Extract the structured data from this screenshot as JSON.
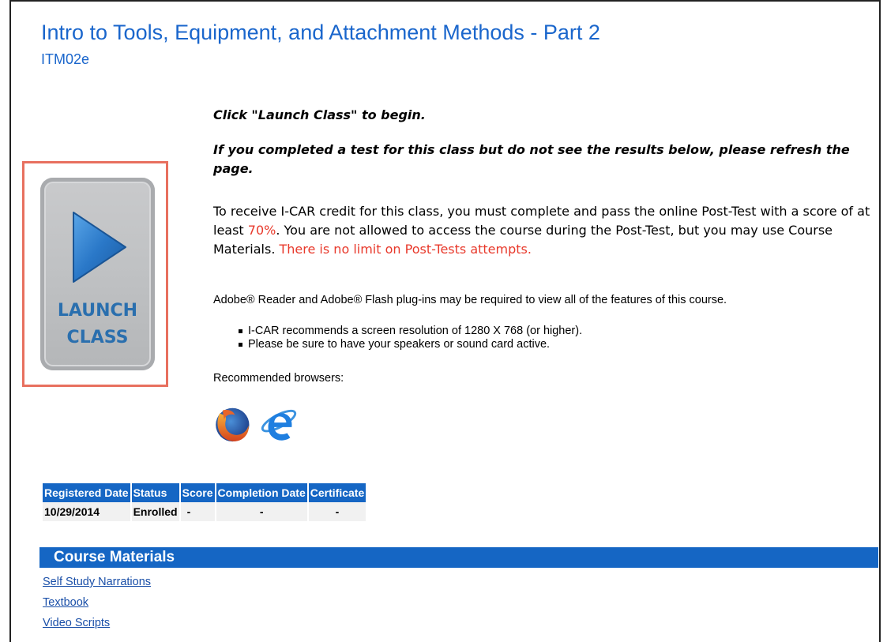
{
  "course": {
    "title": "Intro to Tools, Equipment, and Attachment Methods - Part 2",
    "code": "ITM02e"
  },
  "launch": {
    "line1": "LAUNCH",
    "line2": "CLASS"
  },
  "instructions": {
    "click_text": "Click \"Launch Class\" to begin.",
    "refresh_text": "If you completed a test for this class but do not see the results below, please refresh the page.",
    "credit_prefix": "To receive I-CAR credit for this class, you must complete and pass the online Post-Test with a score of at least ",
    "credit_score": "70%",
    "credit_middle": ". You are not allowed to access the course during the Post-Test, but you may use Course Materials. ",
    "credit_limit": "There is no limit on Post-Tests attempts.",
    "plugins": "Adobe® Reader and Adobe® Flash plug-ins may be required to view all of the features of this course.",
    "bullets": [
      "I-CAR recommends a screen resolution of 1280 X 768 (or higher).",
      "Please be sure to have your speakers or sound card active."
    ],
    "browsers_label": "Recommended browsers:",
    "browser_icons": [
      "firefox-icon",
      "internet-explorer-icon"
    ]
  },
  "status_table": {
    "headers": [
      "Registered Date",
      "Status",
      "Score",
      "Completion Date",
      "Certificate"
    ],
    "row": [
      "10/29/2014",
      "Enrolled",
      "-",
      "-",
      "-"
    ]
  },
  "materials": {
    "heading": "Course Materials",
    "links": [
      "Self Study Narrations",
      "Textbook",
      "Video Scripts"
    ]
  },
  "colors": {
    "accent_blue": "#1566c4",
    "title_blue": "#1a66cc",
    "warning_red": "#e8392b",
    "highlight_border": "#e8705f"
  }
}
